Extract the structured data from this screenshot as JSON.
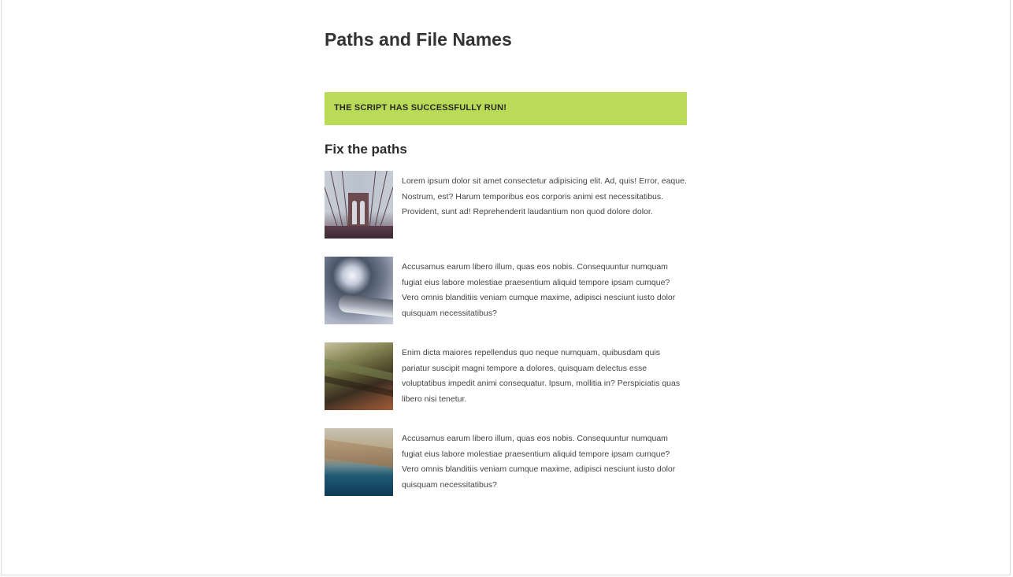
{
  "page": {
    "title": "Paths and File Names"
  },
  "alert": {
    "message": "THE SCRIPT HAS SUCCESSFULLY RUN!",
    "color": "#badb58"
  },
  "section": {
    "title": "Fix the paths"
  },
  "items": [
    {
      "image": "bridge-photo",
      "text": "Lorem ipsum dolor sit amet consectetur adipisicing elit. Ad, quis! Error, eaque. Nostrum, est? Harum temporibus eos corporis animi est necessitatibus. Provident, sunt ad! Reprehenderit laudantium non quod dolore dolor."
    },
    {
      "image": "phone-photo",
      "text": "Accusamus earum libero illum, quas eos nobis. Consequuntur numquam fugiat eius labore molestiae praesentium aliquid tempore ipsam cumque? Vero omnis blanditiis veniam cumque maxime, adipisci nesciunt iusto dolor quisquam necessitatibus?"
    },
    {
      "image": "log-photo",
      "text": "Enim dicta maiores repellendus quo neque numquam, quibusdam quis pariatur suscipit magni tempore a dolores, quisquam delectus esse voluptatibus impedit animi consequatur. Ipsum, mollitia in? Perspiciatis quas libero nisi tenetur."
    },
    {
      "image": "coast-photo",
      "text": "Accusamus earum libero illum, quas eos nobis. Consequuntur numquam fugiat eius labore molestiae praesentium aliquid tempore ipsam cumque? Vero omnis blanditiis veniam cumque maxime, adipisci nesciunt iusto dolor quisquam necessitatibus?"
    }
  ]
}
